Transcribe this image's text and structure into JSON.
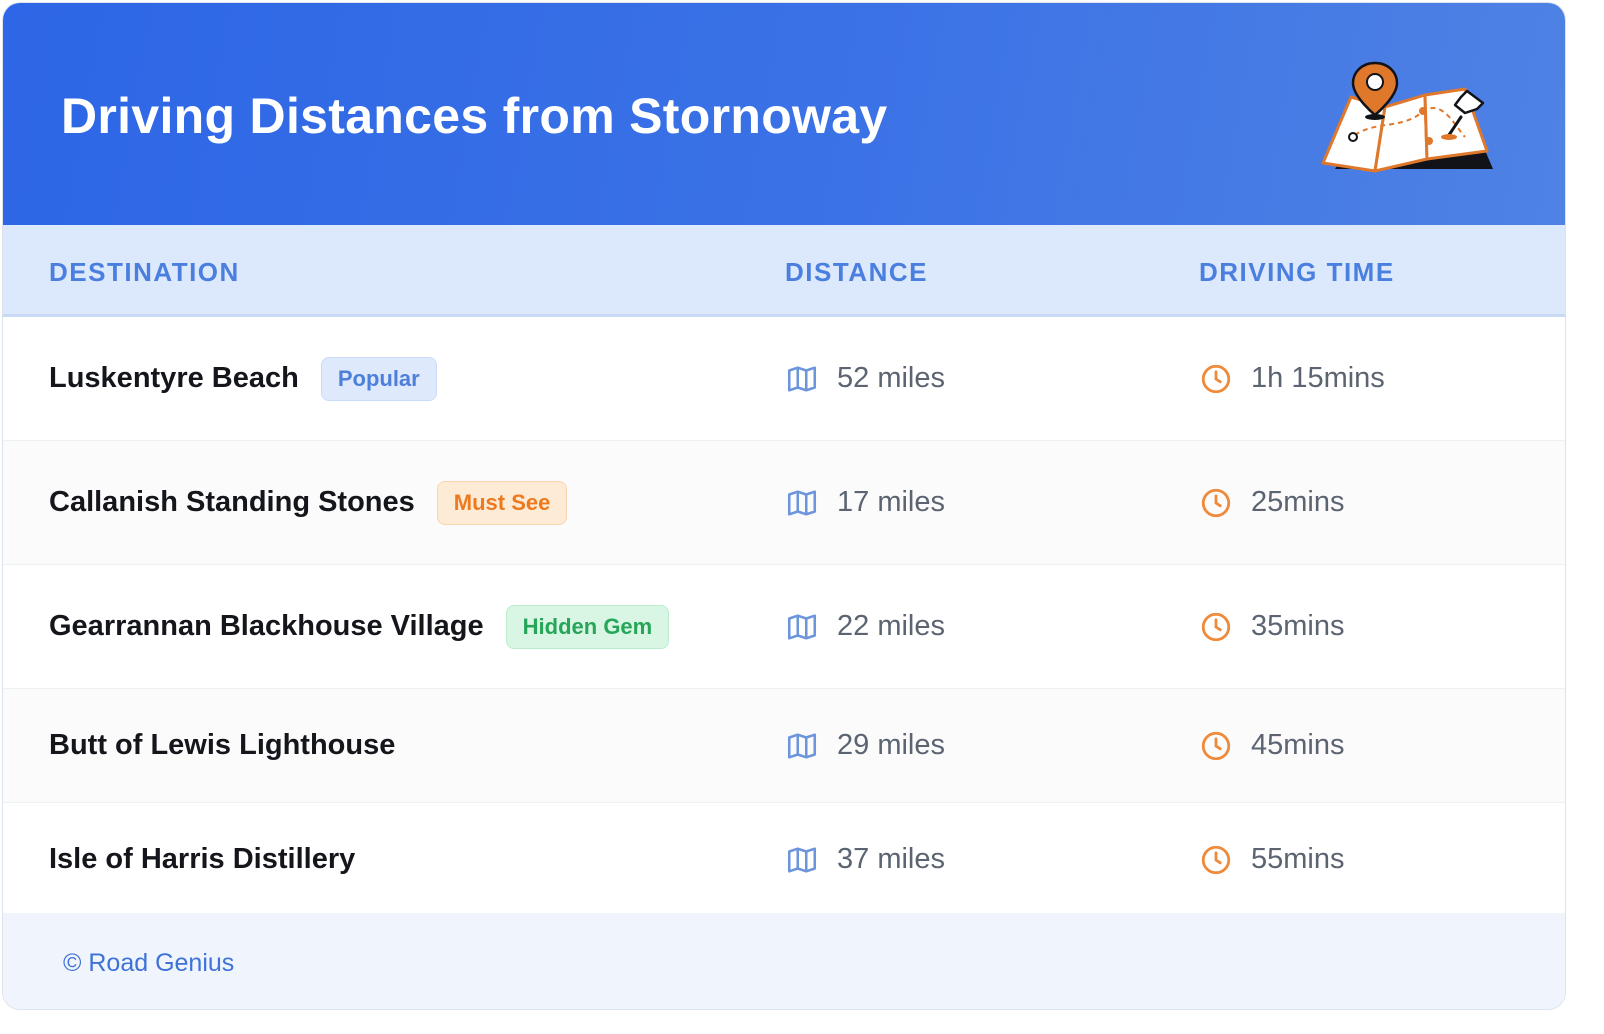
{
  "header": {
    "title": "Driving Distances from Stornoway",
    "art_icon": "folded-map-with-pins-icon"
  },
  "table": {
    "columns": [
      "DESTINATION",
      "DISTANCE",
      "DRIVING TIME"
    ],
    "distance_icon": "map-icon",
    "time_icon": "clock-icon",
    "rows": [
      {
        "destination": "Luskentyre Beach",
        "badge": "Popular",
        "badge_type": "popular",
        "distance": "52 miles",
        "time": "1h 15mins"
      },
      {
        "destination": "Callanish Standing Stones",
        "badge": "Must See",
        "badge_type": "mustsee",
        "distance": "17 miles",
        "time": "25mins"
      },
      {
        "destination": "Gearrannan Blackhouse Village",
        "badge": "Hidden Gem",
        "badge_type": "hidden",
        "distance": "22 miles",
        "time": "35mins"
      },
      {
        "destination": "Butt of Lewis Lighthouse",
        "badge": "",
        "badge_type": "",
        "distance": "29 miles",
        "time": "45mins"
      },
      {
        "destination": "Isle of Harris Distillery",
        "badge": "",
        "badge_type": "",
        "distance": "37 miles",
        "time": "55mins"
      }
    ]
  },
  "footer": {
    "text": "© Road Genius"
  },
  "colors": {
    "header_gradient_start": "#2d66e6",
    "header_gradient_end": "#4f82e4",
    "column_header_text": "#4a7fe0",
    "column_header_bg": "#dce8fb",
    "icon_map": "#6d95dc",
    "icon_clock": "#ef8a3a",
    "badge_popular": "#4d7fdb",
    "badge_mustsee": "#ee7a1f",
    "badge_hidden": "#27a65a"
  }
}
